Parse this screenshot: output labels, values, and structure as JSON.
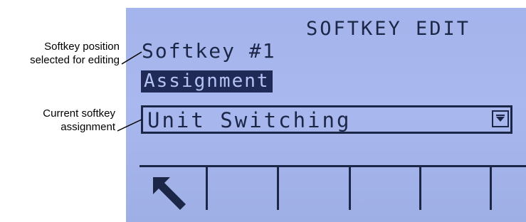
{
  "callouts": {
    "softkey_position": {
      "line1": "Softkey position",
      "line2": "selected for editing"
    },
    "current_assignment": {
      "line1": "Current softkey",
      "line2": "assignment"
    }
  },
  "screen": {
    "title": "SOFTKEY EDIT",
    "softkey_label": "Softkey #1",
    "selected_field": "Assignment",
    "dropdown": {
      "value": "Unit Switching",
      "icon": "dropdown-arrow-icon"
    },
    "softkeys": [
      {
        "icon": "back-arrow-icon",
        "label": ""
      },
      {
        "icon": "",
        "label": ""
      },
      {
        "icon": "",
        "label": ""
      },
      {
        "icon": "",
        "label": ""
      },
      {
        "icon": "",
        "label": ""
      }
    ]
  },
  "colors": {
    "lcd_background": "#a4b4ec",
    "lcd_foreground": "#1c2748",
    "highlight_background": "#202a56",
    "highlight_text": "#b4c3f4"
  }
}
